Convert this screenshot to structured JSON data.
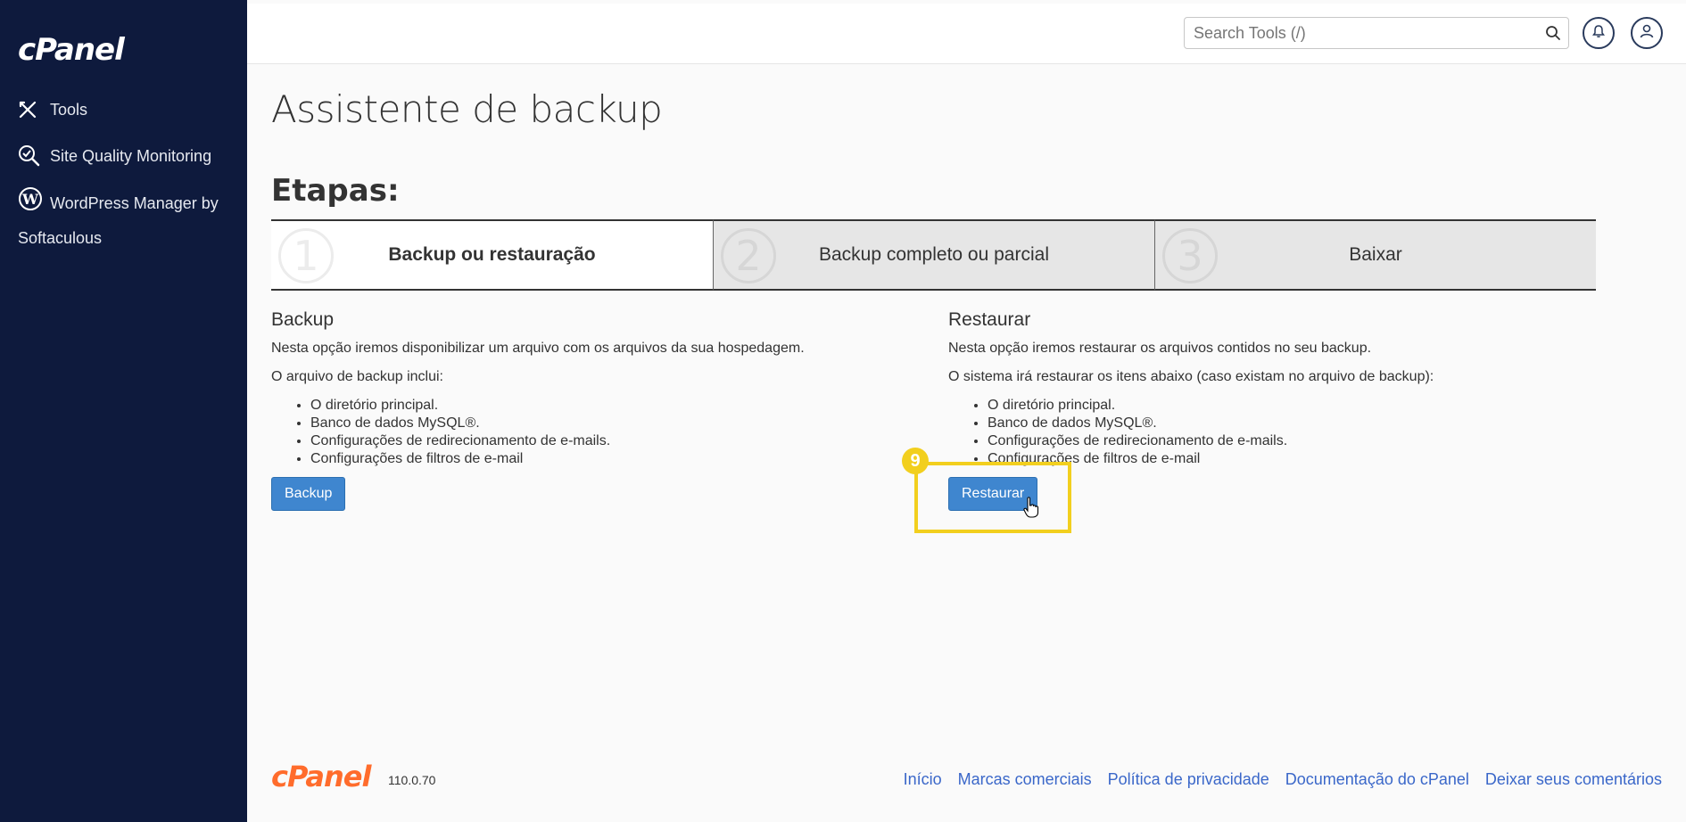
{
  "sidebar": {
    "logo": "cPanel",
    "items": [
      {
        "label": "Tools",
        "icon": "tools-icon"
      },
      {
        "label": "Site Quality Monitoring",
        "icon": "site-quality-icon"
      },
      {
        "label": "WordPress Manager by Softaculous",
        "icon": "wordpress-icon"
      }
    ]
  },
  "header": {
    "search_placeholder": "Search Tools (/)",
    "notifications_icon": "bell-icon",
    "user_icon": "user-icon"
  },
  "main": {
    "title": "Assistente de backup",
    "steps_title": "Etapas:",
    "steps": [
      {
        "num": "1",
        "label": "Backup ou restauração",
        "active": true
      },
      {
        "num": "2",
        "label": "Backup completo ou parcial",
        "active": false
      },
      {
        "num": "3",
        "label": "Baixar",
        "active": false
      }
    ],
    "backup": {
      "heading": "Backup",
      "description": "Nesta opção iremos disponibilizar um arquivo com os arquivos da sua hospedagem.",
      "includes_label": "O arquivo de backup inclui:",
      "items": [
        "O diretório principal.",
        "Banco de dados MySQL®.",
        "Configurações de redirecionamento de e-mails.",
        "Configurações de filtros de e-mail"
      ],
      "button": "Backup"
    },
    "restore": {
      "heading": "Restaurar",
      "description": "Nesta opção iremos restaurar os arquivos contidos no seu backup.",
      "includes_label": "O sistema irá restaurar os itens abaixo (caso existam no arquivo de backup):",
      "items": [
        "O diretório principal.",
        "Banco de dados MySQL®.",
        "Configurações de redirecionamento de e-mails.",
        "Configurações de filtros de e-mail"
      ],
      "button": "Restaurar"
    },
    "annotation_badge": "9"
  },
  "footer": {
    "logo": "cPanel",
    "version": "110.0.70",
    "links": [
      "Início",
      "Marcas comerciais",
      "Política de privacidade",
      "Documentação do cPanel",
      "Deixar seus comentários"
    ]
  },
  "colors": {
    "sidebar_bg": "#0e1a3d",
    "accent_button": "#3f86cf",
    "highlight": "#f2cf1e",
    "footer_logo": "#ff6c2c",
    "link": "#3a67c9"
  }
}
